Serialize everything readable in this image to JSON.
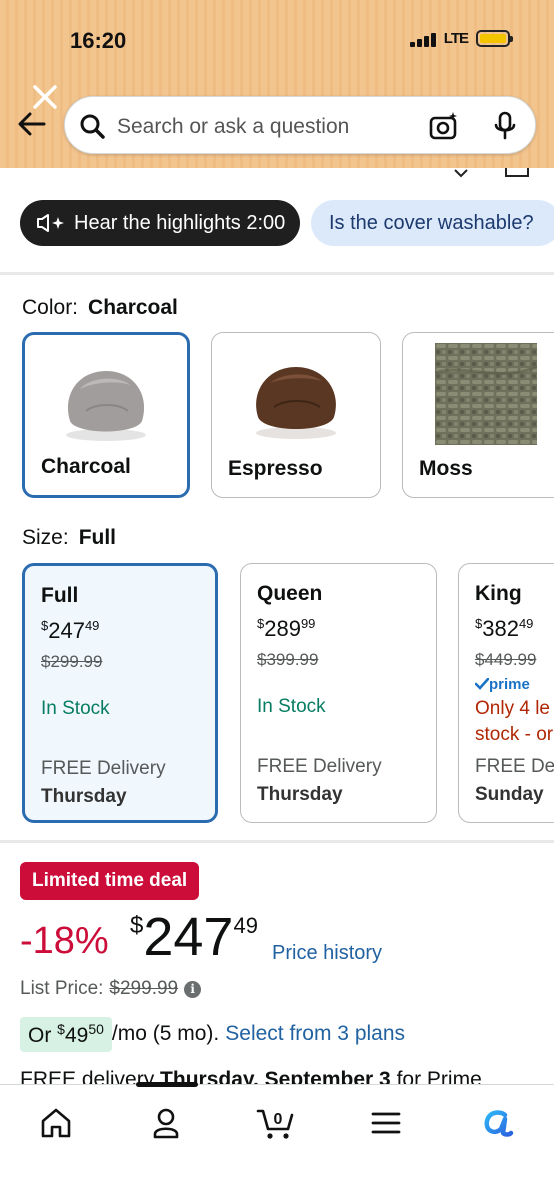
{
  "status_bar": {
    "time": "16:20",
    "network": "LTE"
  },
  "header": {
    "search_placeholder": "Search or ask a question"
  },
  "highlights": {
    "button_label": "Hear the highlights 2:00",
    "question_chip": "Is the cover washable?"
  },
  "color": {
    "label": "Color:",
    "selected": "Charcoal",
    "options": [
      {
        "name": "Charcoal",
        "swatch_color": "#9c9898",
        "selected": true
      },
      {
        "name": "Espresso",
        "swatch_color": "#5e3a24",
        "selected": false
      },
      {
        "name": "Moss",
        "swatch_color": "#7a7b66",
        "selected": false
      }
    ]
  },
  "size": {
    "label": "Size:",
    "selected": "Full",
    "options": [
      {
        "name": "Full",
        "price_dollars": "247",
        "price_cents": "49",
        "list_price": "$299.99",
        "prime": "",
        "stock": "In Stock",
        "delivery_label": "FREE Delivery",
        "delivery_day": "Thursday",
        "selected": true
      },
      {
        "name": "Queen",
        "price_dollars": "289",
        "price_cents": "99",
        "list_price": "$399.99",
        "prime": "",
        "stock": "In Stock",
        "delivery_label": "FREE Delivery",
        "delivery_day": "Thursday",
        "selected": false
      },
      {
        "name": "King",
        "price_dollars": "382",
        "price_cents": "49",
        "list_price": "$449.99",
        "prime": "prime",
        "stock_line1": "Only 4 le",
        "stock_line2": "stock - or",
        "delivery_label": "FREE Del",
        "delivery_day": "Sunday",
        "selected": false
      }
    ]
  },
  "deal": {
    "badge": "Limited time deal",
    "discount": "-18%",
    "currency": "$",
    "price_dollars": "247",
    "price_cents": "49",
    "price_history_link": "Price history",
    "list_price_label": "List Price:",
    "list_price": "$299.99",
    "info_icon": "i",
    "monthly_prefix": "Or ",
    "monthly_currency": "$",
    "monthly_dollars": "49",
    "monthly_cents": "50",
    "monthly_suffix": " /mo (5 mo).",
    "plans_link": "Select from 3 plans",
    "delivery_prefix": "FREE delivery ",
    "delivery_date": "Thursday, September 3",
    "delivery_suffix": " for Prime"
  },
  "bottom_nav": {
    "cart_count": "0",
    "items": [
      "home-icon",
      "account-icon",
      "cart-icon",
      "menu-icon",
      "rufus-icon"
    ]
  },
  "colors": {
    "accent_blue": "#2b6cb0",
    "deal_red": "#cc0c39",
    "in_stock_green": "#067d62",
    "link_blue": "#2162a1",
    "header_orange": "#f2c48e"
  }
}
